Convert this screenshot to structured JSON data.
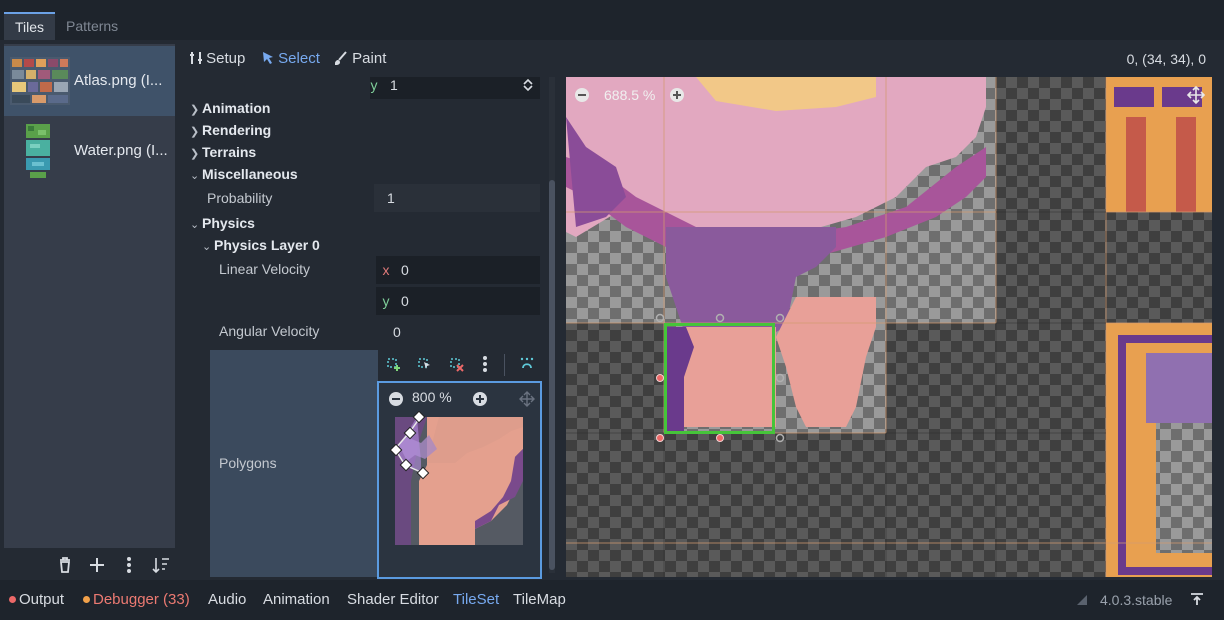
{
  "top_tabs": [
    {
      "label": "Tiles"
    },
    {
      "label": "Patterns"
    }
  ],
  "sources": [
    {
      "label": "Atlas.png (I..."
    },
    {
      "label": "Water.png (I..."
    }
  ],
  "toolbar": {
    "setup": "Setup",
    "select": "Select",
    "paint": "Paint",
    "coords": "0, (34, 34), 0"
  },
  "inspector": {
    "y_axis": "y",
    "y_value": "1",
    "sections": {
      "animation": "Animation",
      "rendering": "Rendering",
      "terrains": "Terrains",
      "miscellaneous": "Miscellaneous",
      "physics": "Physics",
      "physics_layer": "Physics Layer 0"
    },
    "probability": {
      "label": "Probability",
      "value": "1"
    },
    "linear_velocity": {
      "label": "Linear Velocity",
      "x_axis": "x",
      "x": "0",
      "y_axis": "y",
      "y": "0"
    },
    "angular_velocity": {
      "label": "Angular Velocity",
      "value": "0"
    },
    "polygons": {
      "label": "Polygons",
      "zoom": "800 %"
    }
  },
  "viewport": {
    "zoom": "688.5 %"
  },
  "statusbar": {
    "output": "Output",
    "debugger": "Debugger (33)",
    "audio": "Audio",
    "animation": "Animation",
    "shader_editor": "Shader Editor",
    "tileset": "TileSet",
    "tilemap": "TileMap",
    "version": "4.0.3.stable"
  },
  "colors": {
    "accent": "#6ba1e6",
    "selection": "#46c43a",
    "error": "#ec6868",
    "warning": "#f2a14a"
  }
}
